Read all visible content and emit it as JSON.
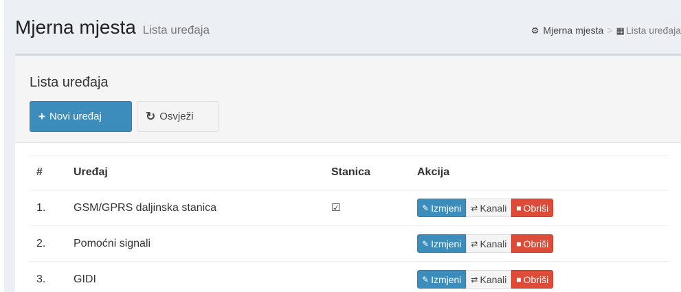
{
  "header": {
    "title": "Mjerna mjesta",
    "subtitle": "Lista uređaja"
  },
  "breadcrumb": {
    "home_icon": "dashboard-icon",
    "home_label": "Mjerna mjesta",
    "separator": ">",
    "current_icon": "chip-icon",
    "current_label": "Lista uređaja"
  },
  "box": {
    "title": "Lista uređaja",
    "new_button": "Novi uređaj",
    "refresh_button": "Osvježi"
  },
  "table": {
    "columns": [
      "#",
      "Uređaj",
      "Stanica",
      "Akcija"
    ],
    "rows": [
      {
        "num": "1.",
        "device": "GSM/GPRS daljinska stanica",
        "station": true
      },
      {
        "num": "2.",
        "device": "Pomoćni signali",
        "station": false
      },
      {
        "num": "3.",
        "device": "GIDI",
        "station": false
      }
    ],
    "actions": {
      "edit": "Izmjeni",
      "channels": "Kanali",
      "delete": "Obriši"
    }
  },
  "colors": {
    "primary": "#3c8dbc",
    "danger": "#dd4b39",
    "background": "#ecf0f5"
  }
}
